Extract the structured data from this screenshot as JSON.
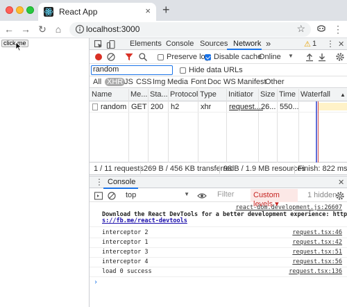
{
  "browser": {
    "tab_title": "React App",
    "tab_close": "×",
    "new_tab": "+",
    "url": "localhost:3000",
    "back": "←",
    "forward": "→",
    "reload": "↻",
    "home": "⌂",
    "star": "☆",
    "menu": "⋮"
  },
  "page": {
    "button_label": "click me"
  },
  "devtools": {
    "tabs": [
      "Elements",
      "Console",
      "Sources",
      "Network"
    ],
    "active_tab": "Network",
    "more_tabs": "»",
    "warning_count": "1",
    "close": "✕",
    "menu": "⋮",
    "network": {
      "preserve_log": "Preserve log",
      "preserve_log_checked": false,
      "disable_cache": "Disable cache",
      "disable_cache_checked": true,
      "throttling": "Online",
      "filter_value": "random",
      "hide_data_urls": "Hide data URLs",
      "types": [
        "All",
        "XHR",
        "JS",
        "CSS",
        "Img",
        "Media",
        "Font",
        "Doc",
        "WS",
        "Manifest",
        "Other"
      ],
      "active_type": "XHR",
      "columns": [
        "Name",
        "Me...",
        "Sta...",
        "Protocol",
        "Type",
        "Initiator",
        "Size",
        "Time",
        "Waterfall"
      ],
      "rows": [
        {
          "name": "random",
          "method": "GET",
          "status": "200",
          "protocol": "h2",
          "type": "xhr",
          "initiator": "request....",
          "size": "26...",
          "time": "550..."
        }
      ],
      "summary": {
        "requests": "1 / 11 requests",
        "transferred": "269 B / 456 KB transferred",
        "resources": "98 B / 1.9 MB resources",
        "finish": "Finish: 822 ms"
      }
    },
    "console": {
      "drawer_title": "Console",
      "context": "top",
      "filter_placeholder": "Filter",
      "levels": "Custom levels ▾",
      "hidden": "1 hidden",
      "messages": [
        {
          "text": "Download the React DevTools for a better development experience: http",
          "text2": "s://fb.me/react-devtools",
          "source": "react-dom.development.js:26607",
          "bold": true
        },
        {
          "text": "interceptor 2",
          "source": "request.tsx:46"
        },
        {
          "text": "interceptor 1",
          "source": "request.tsx:42"
        },
        {
          "text": "interceptor 3",
          "source": "request.tsx:51"
        },
        {
          "text": "interceptor 4",
          "source": "request.tsx:56"
        },
        {
          "text": "load 0 success",
          "source": "request.tsx:136"
        }
      ],
      "prompt": "›"
    }
  },
  "colors": {
    "accent": "#1a73e8",
    "record_red": "#d93025",
    "filter_red": "#d93025",
    "levels_bg": "#fce8e6"
  }
}
